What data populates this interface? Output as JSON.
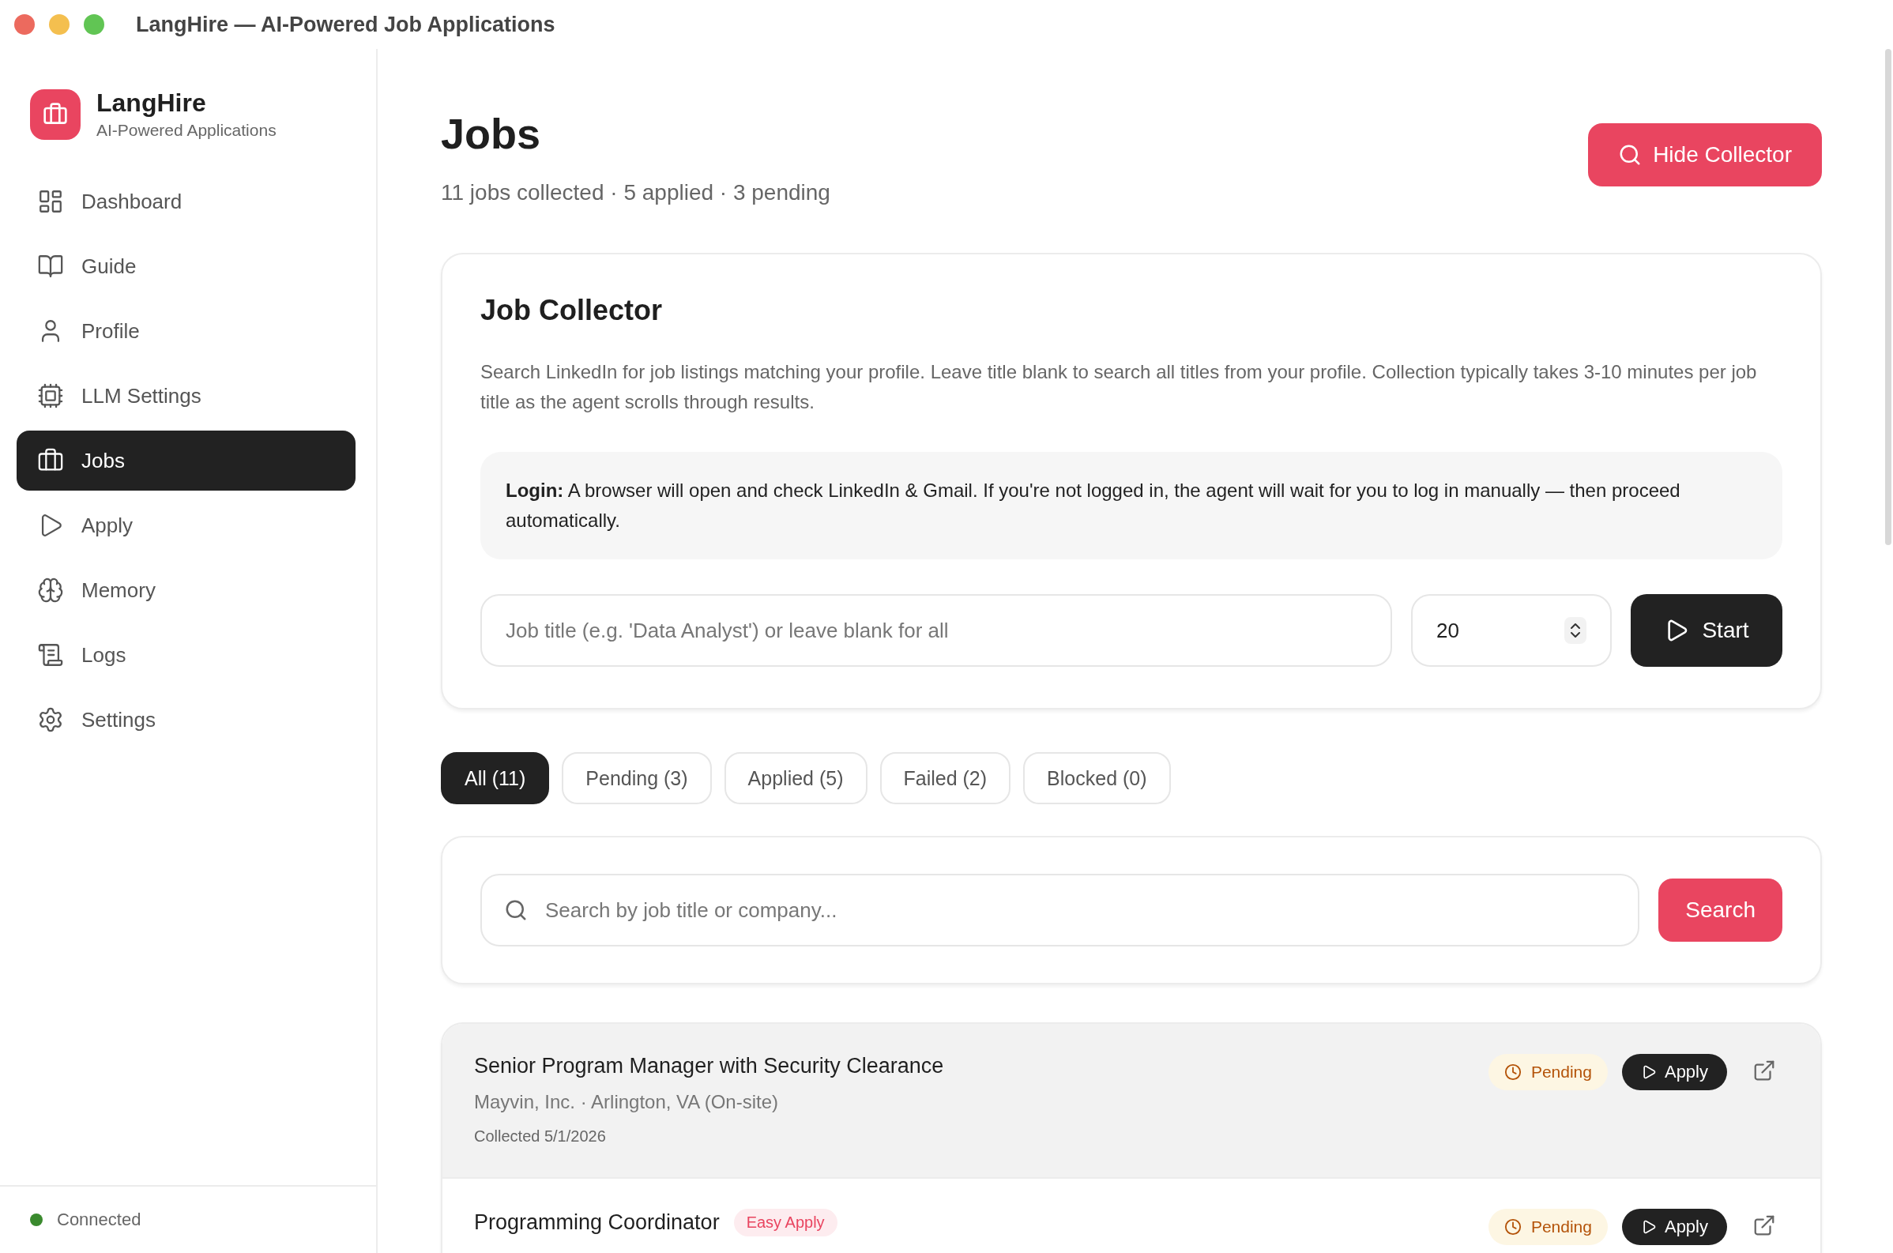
{
  "window": {
    "title": "LangHire — AI-Powered Job Applications"
  },
  "sidebar": {
    "app_name": "LangHire",
    "tagline": "AI-Powered Applications",
    "items": [
      {
        "label": "Dashboard",
        "selected": false
      },
      {
        "label": "Guide",
        "selected": false
      },
      {
        "label": "Profile",
        "selected": false
      },
      {
        "label": "LLM Settings",
        "selected": false
      },
      {
        "label": "Jobs",
        "selected": true
      },
      {
        "label": "Apply",
        "selected": false
      },
      {
        "label": "Memory",
        "selected": false
      },
      {
        "label": "Logs",
        "selected": false
      },
      {
        "label": "Settings",
        "selected": false
      }
    ],
    "status": {
      "label": "Connected",
      "connected": true
    }
  },
  "page": {
    "title": "Jobs",
    "summary": "11 jobs collected · 5 applied · 3 pending",
    "hide_button": "Hide Collector"
  },
  "collector": {
    "title": "Job Collector",
    "description": "Search LinkedIn for job listings matching your profile. Leave title blank to search all titles from your profile. Collection typically takes 3-10 minutes per job title as the agent scrolls through results.",
    "notice": "**Login:** A browser will open and check LinkedIn & Gmail. If you're not logged in, the agent will wait for you to log in manually — then proceed automatically.",
    "title_field": {
      "placeholder": "Job title (e.g. 'Data Analyst') or leave blank for all"
    },
    "count_field": {
      "value": "20"
    },
    "start_button": "Start"
  },
  "filters": [
    {
      "label": "All (11)",
      "selected": true
    },
    {
      "label": "Pending (3)",
      "selected": false
    },
    {
      "label": "Applied (5)",
      "selected": false
    },
    {
      "label": "Failed (2)",
      "selected": false
    },
    {
      "label": "Blocked (0)",
      "selected": false
    }
  ],
  "search": {
    "placeholder": "Search by job title or company...",
    "button": "Search"
  },
  "jobs": [
    {
      "title": "Senior Program Manager with Security Clearance",
      "company": "Mayvin, Inc. · Arlington, VA (On-site)",
      "collected": "Collected 5/1/2026",
      "selected": true,
      "status": "Pending",
      "apply_button": "Apply"
    },
    {
      "title": "Programming Coordinator",
      "badge": "Easy Apply",
      "selected": false,
      "status": "Pending",
      "apply_button": "Apply"
    }
  ]
}
